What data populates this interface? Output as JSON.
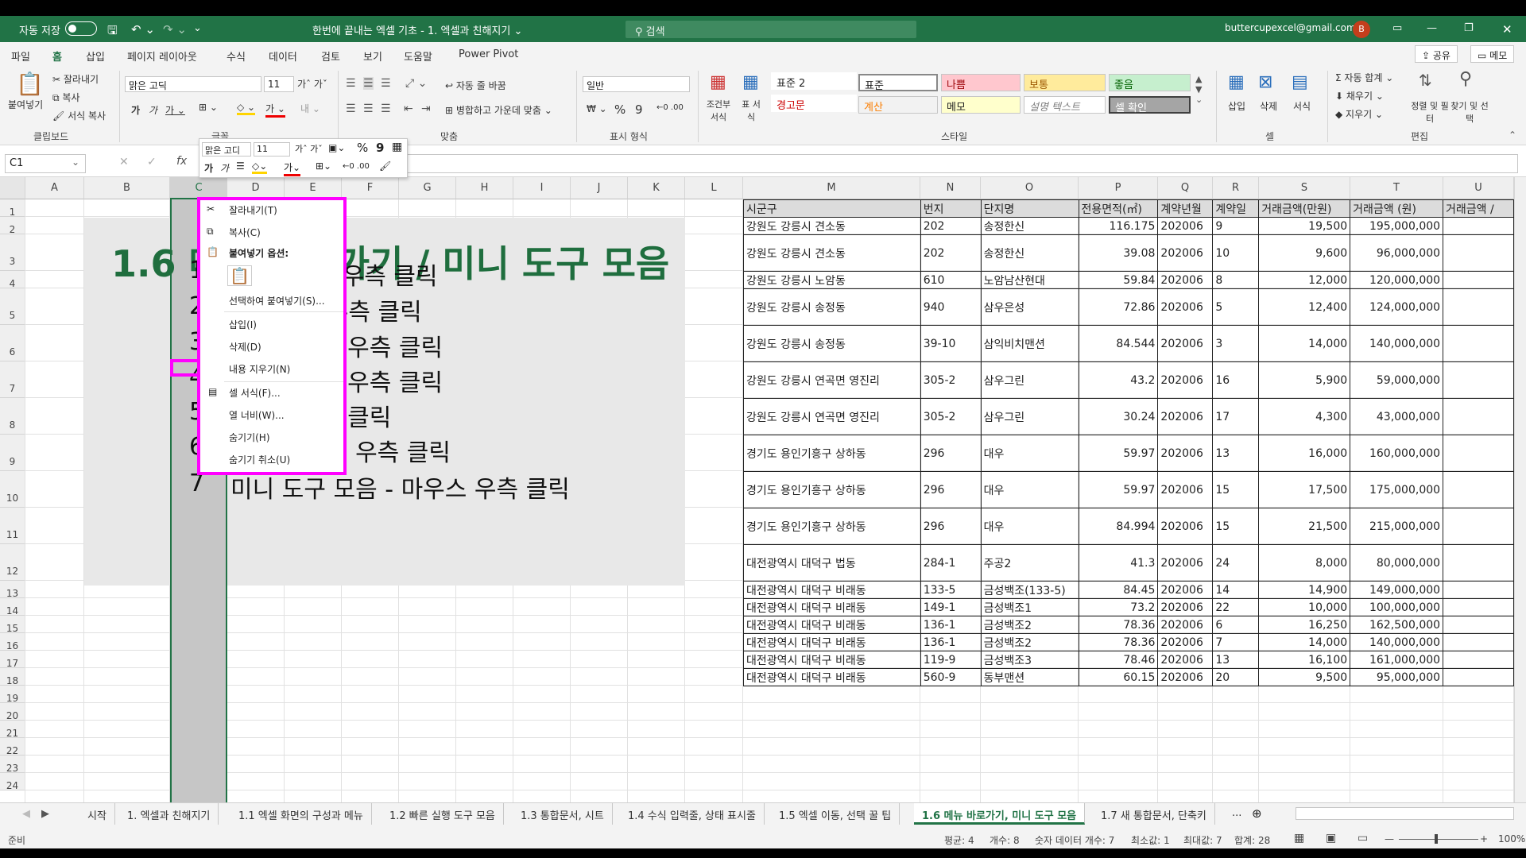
{
  "titlebar": {
    "autosave": "자동 저장",
    "doc_title": "한번에 끝내는 엑셀 기초 - 1. 엑셀과 친해지기 ⌄",
    "search": "검색",
    "account": "buttercupexcel@gmail.com",
    "avatar": "B"
  },
  "menu": [
    "파일",
    "홈",
    "삽입",
    "페이지 레이아웃",
    "수식",
    "데이터",
    "검토",
    "보기",
    "도움말",
    "Power Pivot"
  ],
  "share": "공유",
  "memo": "메모",
  "ribbon": {
    "paste": "붙여넣기",
    "cut": "잘라내기",
    "copy": "복사",
    "format_painter": "서식 복사",
    "clipboard": "클립보드",
    "font_name": "맑은 고딕",
    "font_size": "11",
    "font_group": "글꼴",
    "wrap": "자동 줄 바꿈",
    "merge": "병합하고 가운데 맞춤",
    "align_group": "맞춤",
    "number_format": "일반",
    "number_group": "표시 형식",
    "cond": "조건부 서식",
    "table": "표 서식",
    "styles": [
      "표준 2",
      "표준",
      "나쁨",
      "보통",
      "좋음",
      "경고문",
      "계산",
      "메모",
      "설명 텍스트",
      "셀 확인"
    ],
    "style_group": "스타일",
    "insert": "삽입",
    "delete": "삭제",
    "format": "서식",
    "cells_group": "셀",
    "autosum": "자동 합계",
    "fill": "채우기",
    "clear": "지우기",
    "sort": "정렬 및 필터",
    "find": "찾기 및 선택",
    "edit_group": "편집"
  },
  "namebox": "C1",
  "columns": [
    "A",
    "B",
    "C",
    "D",
    "E",
    "F",
    "G",
    "H",
    "I",
    "J",
    "K",
    "L",
    "M",
    "N",
    "O",
    "P",
    "Q",
    "R",
    "S",
    "T",
    "U"
  ],
  "rows": [
    "1",
    "2",
    "3",
    "4",
    "5",
    "6",
    "7",
    "8",
    "9",
    "10",
    "11",
    "12",
    "13",
    "14",
    "15",
    "16",
    "17",
    "18",
    "19",
    "20",
    "21",
    "22",
    "23",
    "24"
  ],
  "slide": {
    "title": "1.6 메뉴 바로가기 / 미니 도구 모음",
    "items": [
      {
        "n": "1",
        "t": "  - 마우스 우측 클릭"
      },
      {
        "n": "2",
        "t": "우스 우측 클릭"
      },
      {
        "n": "3",
        "t": "스 우측 클릭"
      },
      {
        "n": "4",
        "t": "스 우측 클릭"
      },
      {
        "n": "5",
        "t": "측 클릭"
      },
      {
        "n": "6",
        "t": "시트 마우스 우측 클릭"
      },
      {
        "n": "7",
        "t": "미니 도구 모음 - 마우스 우측 클릭"
      }
    ],
    "partial1": "기"
  },
  "table": {
    "headers": [
      "시군구",
      "번지",
      "단지명",
      "전용면적(㎡)",
      "계약년월",
      "계약일",
      "거래금액(만원)",
      "거래금액 (원)",
      "거래금액 / "
    ],
    "rows": [
      [
        "강원도 강릉시 견소동",
        "202",
        "송정한신",
        "116.175",
        "202006",
        "9",
        "19,500",
        "195,000,000"
      ],
      [
        "강원도 강릉시 견소동",
        "202",
        "송정한신",
        "39.08",
        "202006",
        "10",
        "9,600",
        "96,000,000"
      ],
      [
        "강원도 강릉시 노암동",
        "610",
        "노암남산현대",
        "59.84",
        "202006",
        "8",
        "12,000",
        "120,000,000"
      ],
      [
        "강원도 강릉시 송정동",
        "940",
        "삼우은성",
        "72.86",
        "202006",
        "5",
        "12,400",
        "124,000,000"
      ],
      [
        "강원도 강릉시 송정동",
        "39-10",
        "삼익비치맨션",
        "84.544",
        "202006",
        "3",
        "14,000",
        "140,000,000"
      ],
      [
        "강원도 강릉시 연곡면 영진리",
        "305-2",
        "삼우그린",
        "43.2",
        "202006",
        "16",
        "5,900",
        "59,000,000"
      ],
      [
        "강원도 강릉시 연곡면 영진리",
        "305-2",
        "삼우그린",
        "30.24",
        "202006",
        "17",
        "4,300",
        "43,000,000"
      ],
      [
        "경기도 용인기흥구 상하동",
        "296",
        "대우",
        "59.97",
        "202006",
        "13",
        "16,000",
        "160,000,000"
      ],
      [
        "경기도 용인기흥구 상하동",
        "296",
        "대우",
        "59.97",
        "202006",
        "15",
        "17,500",
        "175,000,000"
      ],
      [
        "경기도 용인기흥구 상하동",
        "296",
        "대우",
        "84.994",
        "202006",
        "15",
        "21,500",
        "215,000,000"
      ],
      [
        "대전광역시 대덕구 법동",
        "284-1",
        "주공2",
        "41.3",
        "202006",
        "24",
        "8,000",
        "80,000,000"
      ],
      [
        "대전광역시 대덕구 비래동",
        "133-5",
        "금성백조(133-5)",
        "84.45",
        "202006",
        "14",
        "14,900",
        "149,000,000"
      ],
      [
        "대전광역시 대덕구 비래동",
        "149-1",
        "금성백조1",
        "73.2",
        "202006",
        "22",
        "10,000",
        "100,000,000"
      ],
      [
        "대전광역시 대덕구 비래동",
        "136-1",
        "금성백조2",
        "78.36",
        "202006",
        "6",
        "16,250",
        "162,500,000"
      ],
      [
        "대전광역시 대덕구 비래동",
        "136-1",
        "금성백조2",
        "78.36",
        "202006",
        "7",
        "14,000",
        "140,000,000"
      ],
      [
        "대전광역시 대덕구 비래동",
        "119-9",
        "금성백조3",
        "78.46",
        "202006",
        "13",
        "16,100",
        "161,000,000"
      ],
      [
        "대전광역시 대덕구 비래동",
        "560-9",
        "동부맨션",
        "60.15",
        "202006",
        "20",
        "9,500",
        "95,000,000"
      ]
    ]
  },
  "mini": {
    "font": "맑은 고디",
    "size": "11"
  },
  "context_menu": {
    "cut": "잘라내기(T)",
    "copy": "복사(C)",
    "paste_opts": "붙여넣기 옵션:",
    "paste_special": "선택하여 붙여넣기(S)...",
    "insert": "삽입(I)",
    "delete": "삭제(D)",
    "clear": "내용 지우기(N)",
    "format": "셀 서식(F)...",
    "width": "열 너비(W)...",
    "hide": "숨기기(H)",
    "unhide": "숨기기 취소(U)"
  },
  "tabs": [
    "시작",
    "1. 엑셀과 친해지기",
    "1.1 엑셀 화면의 구성과 메뉴",
    "1.2 빠른 실행 도구 모음",
    "1.3 통합문서, 시트",
    "1.4 수식 입력줄, 상태 표시줄",
    "1.5 엑셀 이동, 선택 꿀 팁",
    "1.6 메뉴 바로가기, 미니 도구 모음",
    "1.7 새 통합문서, 단축키",
    "..."
  ],
  "status": {
    "ready": "준비",
    "avg": "평균: 4",
    "count": "개수: 8",
    "numcount": "숫자 데이터 개수: 7",
    "min": "최소값: 1",
    "max": "최대값: 7",
    "sum": "합계: 28",
    "zoom": "100%"
  }
}
